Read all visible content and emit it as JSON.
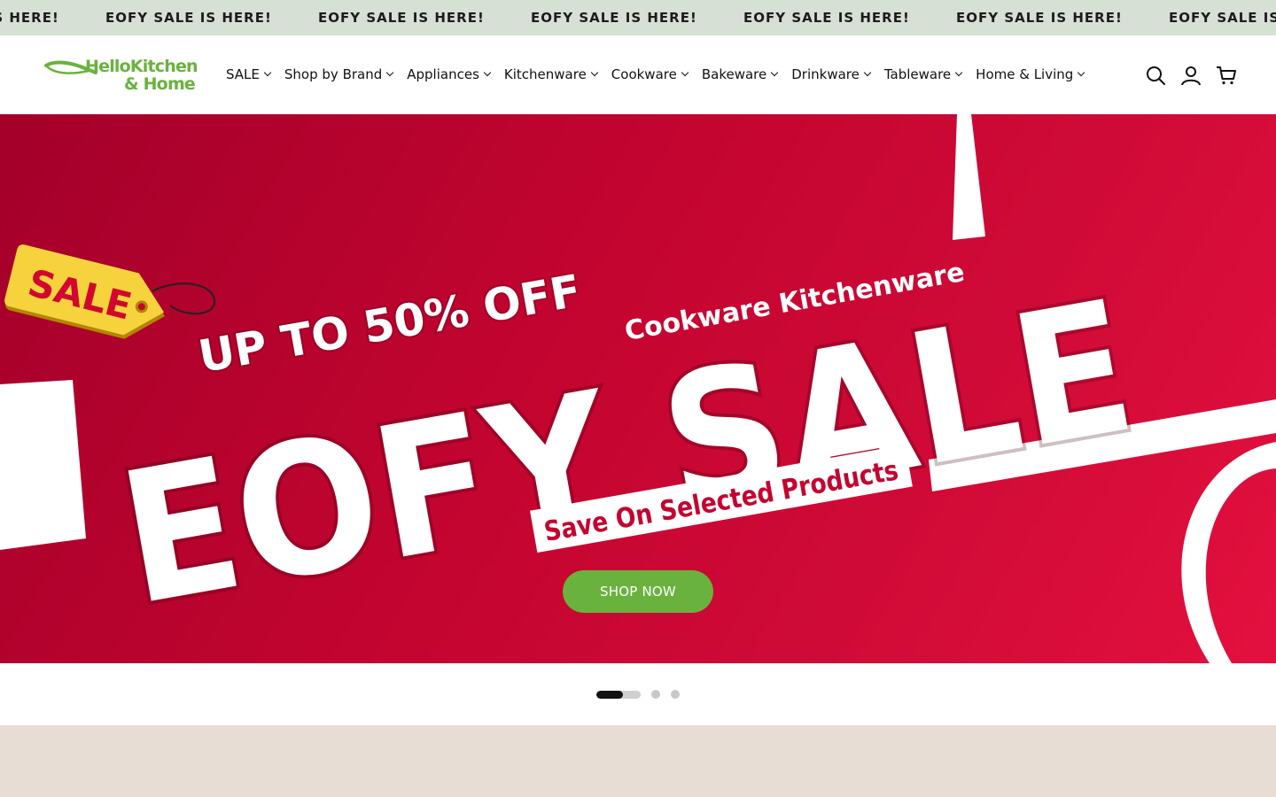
{
  "announcement": {
    "items": [
      "EOFY SALE IS HERE!",
      "EOFY SALE IS HERE!",
      "EOFY SALE IS HERE!",
      "EOFY SALE IS HERE!",
      "EOFY SALE IS HERE!",
      "EOFY SALE IS HERE!",
      "EOFY SALE IS HERE!"
    ],
    "background": "#d6e0d4"
  },
  "brand": {
    "line1": "HelloKitchen",
    "line2": "& Home",
    "color": "#6ab23e"
  },
  "nav": {
    "items": [
      {
        "label": "SALE"
      },
      {
        "label": "Shop by Brand"
      },
      {
        "label": "Appliances"
      },
      {
        "label": "Kitchenware"
      },
      {
        "label": "Cookware"
      },
      {
        "label": "Bakeware"
      },
      {
        "label": "Drinkware"
      },
      {
        "label": "Tableware"
      },
      {
        "label": "Home & Living"
      }
    ]
  },
  "header_icons": [
    "search-icon",
    "account-icon",
    "cart-icon"
  ],
  "hero": {
    "tag_text": "SALE",
    "headline_small": "UP TO 50% OFF",
    "headline_categories": "Cookware Kitchenware",
    "headline_big": "EOFY SALE",
    "subline": "Save On Selected Products",
    "cta_label": "SHOP NOW",
    "background_color": "#c40530",
    "cta_color": "#6ab23e"
  },
  "slider": {
    "total_slides": 3,
    "current_slide": 1,
    "progress": 0.6
  }
}
